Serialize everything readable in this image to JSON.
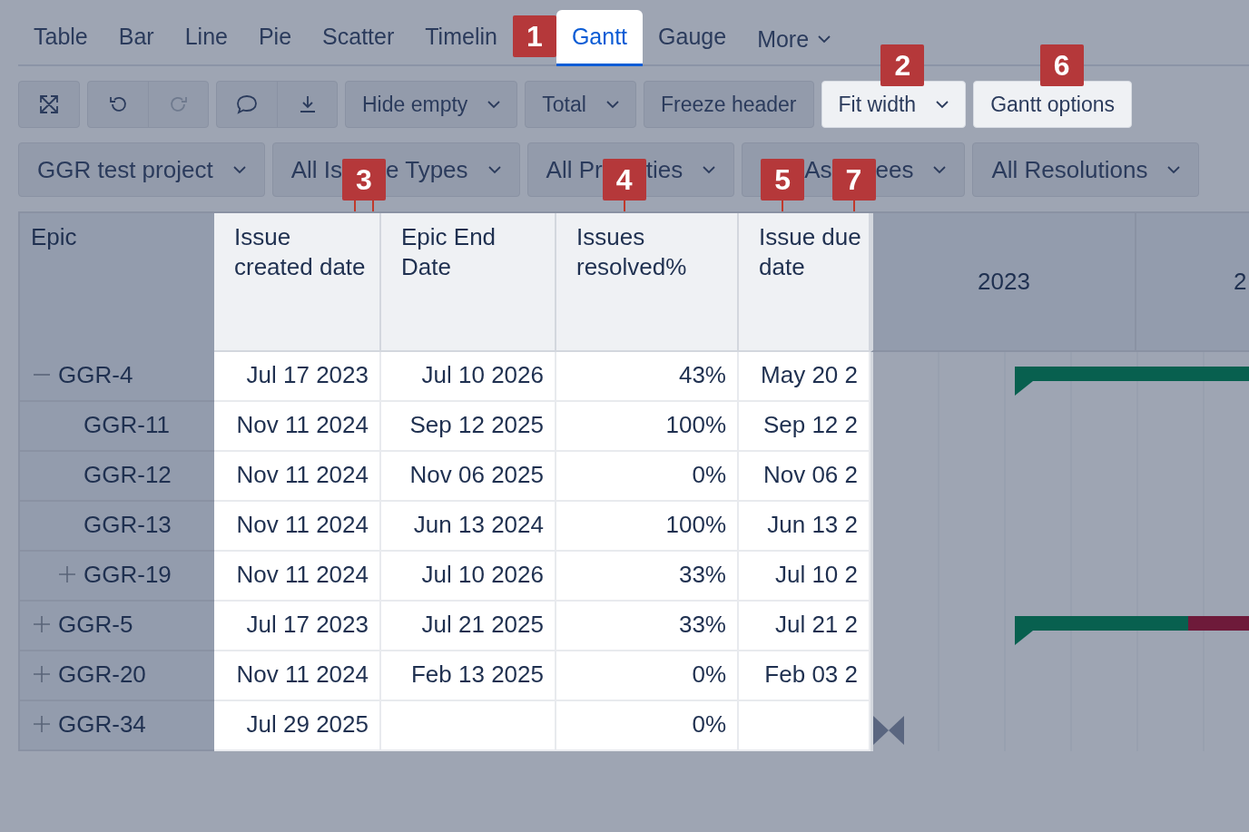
{
  "tabs": [
    {
      "label": "Table",
      "selected": false
    },
    {
      "label": "Bar",
      "selected": false
    },
    {
      "label": "Line",
      "selected": false
    },
    {
      "label": "Pie",
      "selected": false
    },
    {
      "label": "Scatter",
      "selected": false
    },
    {
      "label": "Timelin",
      "selected": false,
      "callout": "1"
    },
    {
      "label": "Gantt",
      "selected": true
    },
    {
      "label": "Gauge",
      "selected": false
    }
  ],
  "more_menu": {
    "label": "More"
  },
  "toolbar": {
    "dropdowns": [
      {
        "label": "Hide empty",
        "kind": "dropdown",
        "highlighted": false
      },
      {
        "label": "Total",
        "kind": "dropdown",
        "highlighted": false
      },
      {
        "label": "Freeze header",
        "kind": "button",
        "highlighted": false
      },
      {
        "label": "Fit width",
        "kind": "dropdown",
        "highlighted": true,
        "callout": "2"
      },
      {
        "label": "Gantt options",
        "kind": "button",
        "highlighted": true,
        "callout": "6"
      }
    ]
  },
  "filters": [
    {
      "segments": [
        {
          "kind": "text",
          "text": "GGR test project"
        }
      ]
    },
    {
      "segments": [
        {
          "kind": "text",
          "text": "All Is"
        },
        {
          "kind": "callout_pair",
          "label": "3"
        },
        {
          "kind": "text",
          "text": "e Types"
        }
      ]
    },
    {
      "segments": [
        {
          "kind": "text",
          "text": "All Pr"
        },
        {
          "kind": "callout",
          "label": "4"
        },
        {
          "kind": "text",
          "text": "ties"
        }
      ]
    },
    {
      "segments": [
        {
          "kind": "callout",
          "label": "5"
        },
        {
          "kind": "text",
          "text": "As"
        },
        {
          "kind": "callout",
          "label": "7"
        },
        {
          "kind": "text",
          "text": "ees"
        }
      ]
    },
    {
      "segments": [
        {
          "kind": "text",
          "text": "All Resolutions"
        }
      ]
    }
  ],
  "table": {
    "row_header": "Epic",
    "columns": [
      "Issue created date",
      "Epic End Date",
      "Issues resolved%",
      "Issue due date"
    ],
    "timeline": [
      "2023",
      "2"
    ],
    "rows": [
      {
        "epic": "GGR-4",
        "expandable": true,
        "expanded": true,
        "cells": [
          "Jul 17 2023",
          "Jul 10 2026",
          "43%",
          "May 20 2"
        ],
        "bar": {
          "kind": "on_track"
        },
        "children": [
          {
            "epic": "GGR-11",
            "expandable": false,
            "expanded": false,
            "cells": [
              "Nov 11 2024",
              "Sep 12 2025",
              "100%",
              "Sep 12 2"
            ]
          },
          {
            "epic": "GGR-12",
            "expandable": false,
            "expanded": false,
            "cells": [
              "Nov 11 2024",
              "Nov 06 2025",
              "0%",
              "Nov 06 2"
            ]
          },
          {
            "epic": "GGR-13",
            "expandable": false,
            "expanded": false,
            "cells": [
              "Nov 11 2024",
              "Jun 13 2024",
              "100%",
              "Jun 13 2"
            ]
          },
          {
            "epic": "GGR-19",
            "expandable": true,
            "expanded": false,
            "cells": [
              "Nov 11 2024",
              "Jul 10 2026",
              "33%",
              "Jul 10 2"
            ]
          }
        ]
      },
      {
        "epic": "GGR-5",
        "expandable": true,
        "expanded": false,
        "cells": [
          "Jul 17 2023",
          "Jul 21 2025",
          "33%",
          "Jul 21 2"
        ],
        "bar": {
          "kind": "overdue"
        }
      },
      {
        "epic": "GGR-20",
        "expandable": true,
        "expanded": false,
        "cells": [
          "Nov 11 2024",
          "Feb 13 2025",
          "0%",
          "Feb 03 2"
        ]
      },
      {
        "epic": "GGR-34",
        "expandable": true,
        "expanded": false,
        "cells": [
          "Jul 29 2025",
          "",
          "0%",
          ""
        ],
        "bar": {
          "kind": "milestone"
        }
      }
    ]
  }
}
